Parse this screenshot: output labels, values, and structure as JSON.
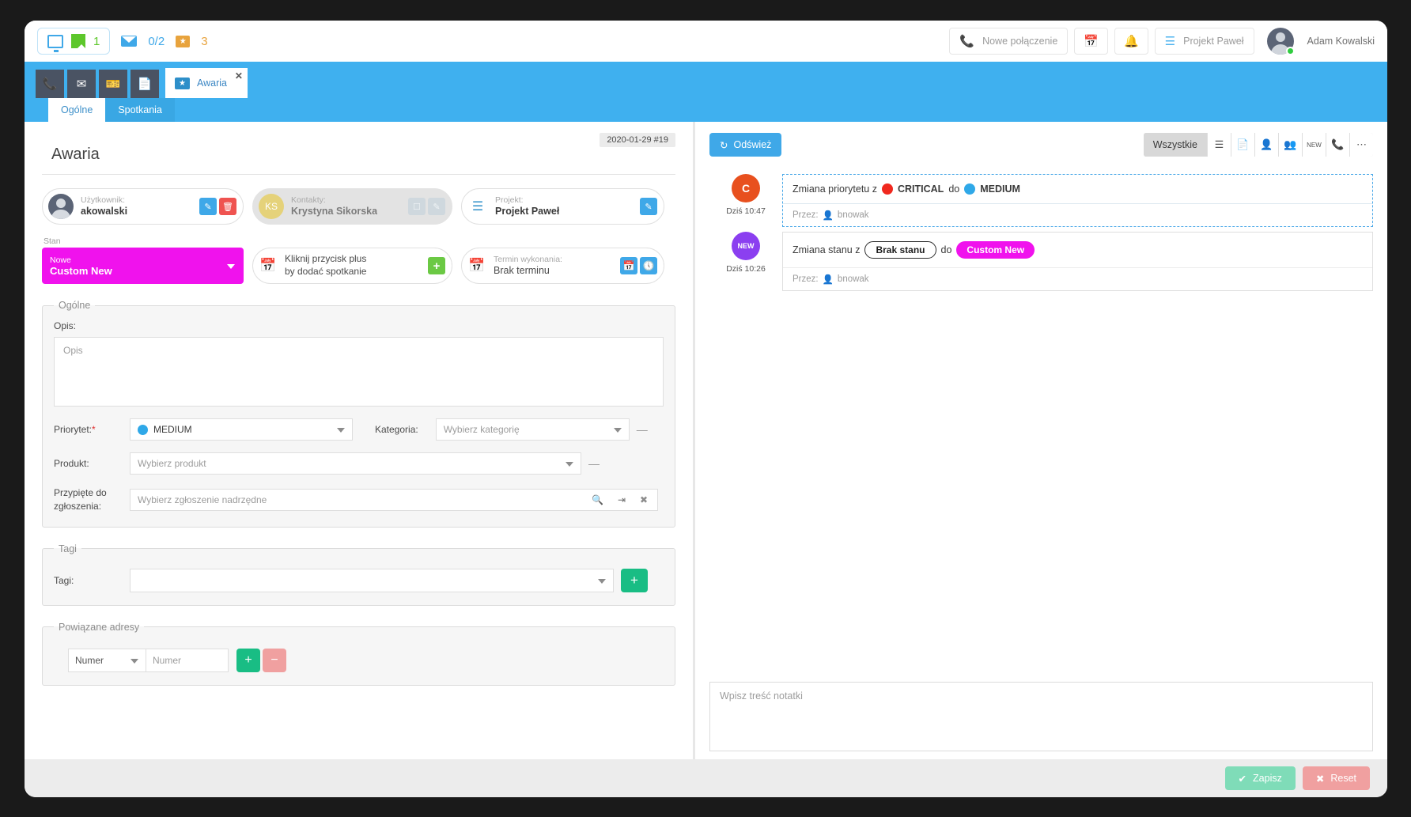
{
  "header": {
    "counters": [
      {
        "icon": "monitor-icon",
        "value": ""
      },
      {
        "icon": "green-page-icon",
        "value": "1"
      },
      {
        "icon": "envelope-icon",
        "value": "0/2"
      },
      {
        "icon": "ticket-icon",
        "value": "3"
      }
    ],
    "new_call_label": "Nowe połączenie",
    "calendar_icon": "calendar-icon",
    "bell_icon": "bell-icon",
    "project_label": "Projekt Paweł",
    "project_icon": "checklist-icon",
    "user_name": "Adam Kowalski"
  },
  "tabbar": {
    "icon_tabs": [
      "phone-icon",
      "envelope-icon",
      "ticket-icon",
      "document-icon"
    ],
    "open_tab": {
      "label": "Awaria",
      "icon": "ticket-icon",
      "close": "✕"
    },
    "subtabs": [
      {
        "label": "Ogólne",
        "active": true
      },
      {
        "label": "Spotkania",
        "active": false
      }
    ]
  },
  "ticket": {
    "date_badge": "2020-01-29 #19",
    "title": "Awaria",
    "user_card": {
      "label": "Użytkownik:",
      "value": "akowalski"
    },
    "contact_card": {
      "label": "Kontakty:",
      "value": "Krystyna Sikorska",
      "initials": "KS"
    },
    "project_card": {
      "label": "Projekt:",
      "value": "Projekt Paweł"
    },
    "state": {
      "label": "Stan",
      "group": "Nowe",
      "value": "Custom New"
    },
    "meeting_card": {
      "line1": "Kliknij przycisk plus",
      "line2": "by dodać spotkanie"
    },
    "deadline_card": {
      "label": "Termin wykonania:",
      "value": "Brak terminu"
    }
  },
  "general": {
    "legend": "Ogólne",
    "opis_label": "Opis:",
    "opis_placeholder": "Opis",
    "priority_label": "Priorytet:",
    "priority_required": "*",
    "priority_value": "MEDIUM",
    "priority_color": "#2fa8e8",
    "category_label": "Kategoria:",
    "category_placeholder": "Wybierz kategorię",
    "product_label": "Produkt:",
    "product_placeholder": "Wybierz produkt",
    "parent_label_line1": "Przypięte do",
    "parent_label_line2": "zgłoszenia:",
    "parent_placeholder": "Wybierz zgłoszenie nadrzędne",
    "minus": "—"
  },
  "tags": {
    "legend": "Tagi",
    "label": "Tagi:",
    "value": "",
    "add": "+"
  },
  "addresses": {
    "legend": "Powiązane adresy",
    "type_value": "Numer",
    "number_placeholder": "Numer",
    "add": "+",
    "remove": "−"
  },
  "activity": {
    "refresh_label": "Odśwież",
    "filter_all": "Wszystkie",
    "filter_icons": [
      "checklist-icon",
      "document-icon",
      "person-icon",
      "people-icon",
      "new-badge-icon",
      "phone-icon",
      "more-icon"
    ],
    "items": [
      {
        "avatar_initial": "C",
        "avatar_color": "#e8501e",
        "time": "Dziś 10:47",
        "kind": "priority",
        "text_before": "Zmiana priorytetu z",
        "from_value": "CRITICAL",
        "from_color": "#f0281e",
        "text_mid": "do",
        "to_value": "MEDIUM",
        "to_color": "#2fa8e8",
        "by_label": "Przez:",
        "by_user": "bnowak"
      },
      {
        "avatar_initial": "NEW",
        "avatar_color": "#8b3ff0",
        "time": "Dziś 10:26",
        "kind": "state",
        "text_before": "Zmiana stanu z",
        "from_value": "Brak stanu",
        "text_mid": "do",
        "to_value": "Custom New",
        "to_color": "#f012ed",
        "by_label": "Przez:",
        "by_user": "bnowak"
      }
    ],
    "note_placeholder": "Wpisz treść notatki"
  },
  "footer": {
    "save_label": "Zapisz",
    "reset_label": "Reset"
  }
}
